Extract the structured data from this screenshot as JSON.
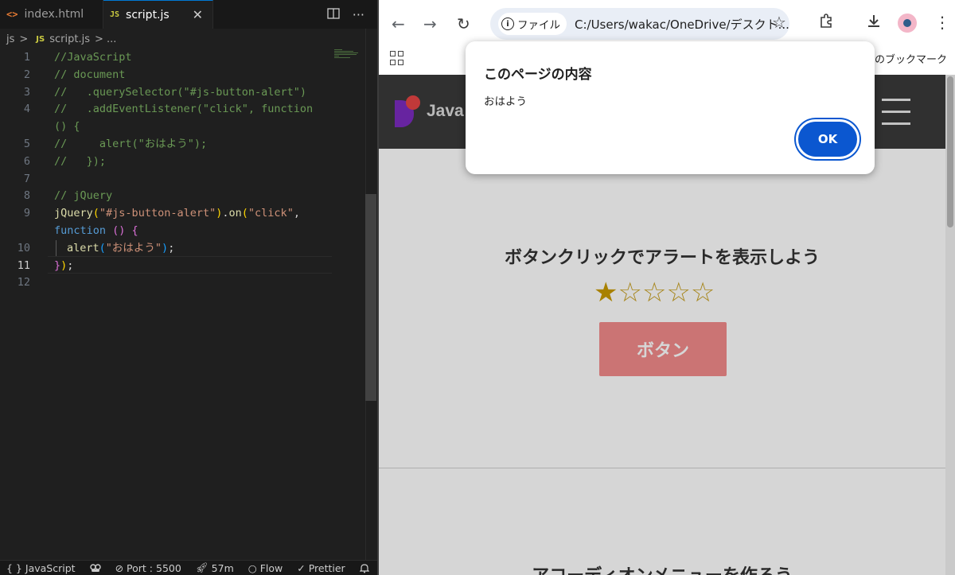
{
  "editor": {
    "tabs": [
      {
        "icon": "<>",
        "label": "index.html"
      },
      {
        "icon": "JS",
        "label": "script.js",
        "close": "✕"
      }
    ],
    "actions": {
      "split": "▯▯",
      "more": "···"
    },
    "breadcrumb": {
      "folder": "js",
      "sep": ">",
      "icon": "JS",
      "file": "script.js",
      "tail": "> ..."
    },
    "line_numbers": [
      "1",
      "2",
      "3",
      "4",
      "",
      "5",
      "6",
      "7",
      "8",
      "9",
      "",
      "10",
      "11",
      "12"
    ],
    "code": {
      "l1": "//JavaScript",
      "l2": "// document",
      "l3": "//   .querySelector(\"#js-button-alert\")",
      "l4": "//   .addEventListener(\"click\", function",
      "l4b": "() {",
      "l5": "//     alert(\"おはよう\");",
      "l6": "//   });",
      "l8": "// jQuery",
      "l9_fn": "jQuery",
      "l9_p": "(",
      "l9_s": "\"#js-button-alert\"",
      "l9_p2": ")",
      "l9_dot": ".",
      "l9_on": "on",
      "l9_p3": "(",
      "l9_s2": "\"click\"",
      "l9_c": ",",
      "l9b_kw": "function",
      "l9b_p": " ()",
      "l9b_b": " {",
      "l10_fn": "alert",
      "l10_p": "(",
      "l10_s": "\"おはよう\"",
      "l10_p2": ")",
      "l10_e": ";",
      "l11_b": "}",
      "l11_p": ")",
      "l11_e": ";"
    },
    "status": {
      "language": "JavaScript",
      "port": "Port : 5500",
      "time": "57m",
      "flow": "Flow",
      "prettier": "Prettier"
    }
  },
  "browser": {
    "chip": "ファイル",
    "url": "C:/Users/wakac/OneDrive/デスクト...",
    "bookmarks_right": "べてのブックマーク",
    "site": {
      "logo_text": "Java",
      "section_title": "ボタンクリックでアラートを表示しよう",
      "stars_filled": "★",
      "stars_empty": "☆☆☆☆",
      "rating": 1,
      "button_label": "ボタン",
      "section2_title": "アコーディオンメニューを作ろう"
    },
    "dialog": {
      "title": "このページの内容",
      "message": "おはよう",
      "ok": "OK"
    }
  },
  "colors": {
    "accent": "#0b57d0",
    "editor_bg": "#1f1f1f",
    "button_bg": "#f28b8b",
    "header_bg": "#3a3a3a"
  }
}
